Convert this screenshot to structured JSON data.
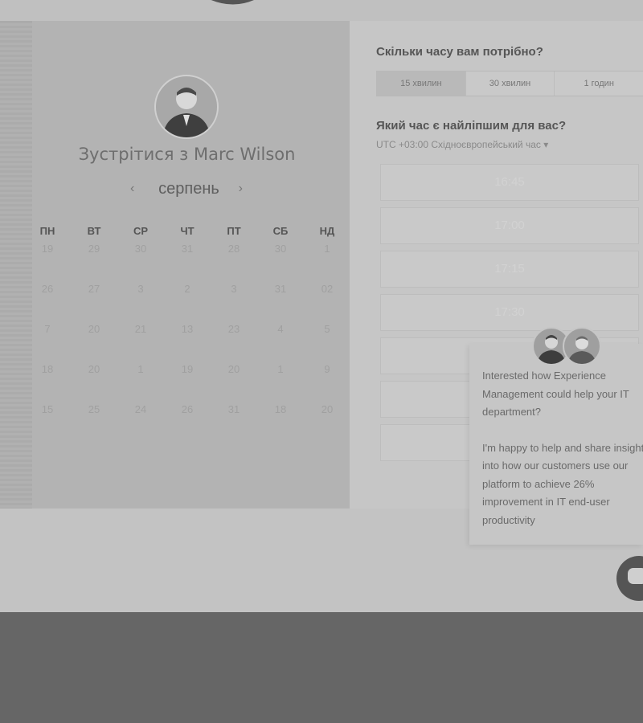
{
  "profile": {
    "meet_title": "Зустрітися з Marc Wilson"
  },
  "calendar": {
    "month": "серпень",
    "prev_symbol": "‹",
    "next_symbol": "›",
    "weekdays": [
      "ПН",
      "ВТ",
      "СР",
      "ЧТ",
      "ПТ",
      "СБ",
      "НД"
    ],
    "weeks": [
      [
        "19",
        "29",
        "30",
        "31",
        "28",
        "30",
        "1"
      ],
      [
        "26",
        "27",
        "3",
        "2",
        "3",
        "31",
        "02"
      ],
      [
        "7",
        "20",
        "21",
        "13",
        "23",
        "4",
        "5"
      ],
      [
        "18",
        "20",
        "1",
        "19",
        "20",
        "1",
        "9"
      ],
      [
        "15",
        "25",
        "24",
        "26",
        "31",
        "18",
        "20"
      ]
    ]
  },
  "duration": {
    "question": "Скільки часу вам потрібно?",
    "options": [
      "15 хвилин",
      "30 хвилин",
      "1 годин"
    ]
  },
  "time": {
    "question": "Який час є найліпшим для вас?",
    "timezone": "UTC +03:00 Східноєвропейський час ▾",
    "slots": [
      "16:45",
      "17:00",
      "17:15",
      "17:30",
      "",
      "",
      ""
    ]
  },
  "chat": {
    "line1": "Interested how Experience Management could help your IT department?",
    "line2": "I'm happy to help and share insight into how our customers use our platform to achieve 26% improvement in IT end-user productivity"
  }
}
